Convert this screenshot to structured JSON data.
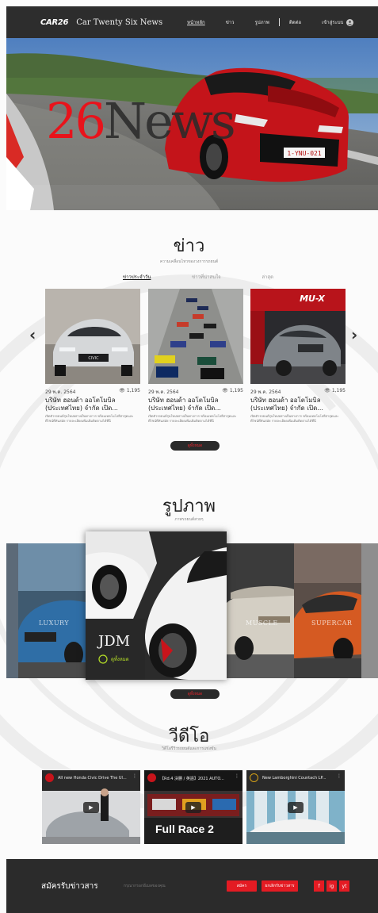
{
  "header": {
    "logo": "CAR26",
    "site_name": "Car Twenty Six News",
    "nav": [
      "หน้าหลัก",
      "ข่าว",
      "รูปภาพ",
      "ติดต่อ",
      "เข้าสู่ระบบ"
    ]
  },
  "hero": {
    "title_number": "26",
    "title_word": "News"
  },
  "news": {
    "title": "ข่าว",
    "subtitle": "ความเคลื่อนไหวของวงการรถยนต์",
    "tabs": [
      "ข่าวประจำวัน",
      "ข่าวที่น่าสนใจ",
      "ล่าสุด"
    ],
    "active_tab": 0,
    "cards": [
      {
        "date": "29 พ.ค. 2564",
        "views": "1,195",
        "title": "บริษัท ฮอนด้า ออโตโมบิล (ประเทศไทย) จำกัด เปิด...",
        "desc": "เปิดตัวรถยนต์รุ่นใหม่อย่างเป็นทางการ พร้อมเทคโนโลยีล่าสุดและดีไซน์ที่ทันสมัย รายละเอียดเพิ่มเติมติดตามได้ที่นี่"
      },
      {
        "date": "29 พ.ค. 2564",
        "views": "1,195",
        "title": "บริษัท ฮอนด้า ออโตโมบิล (ประเทศไทย) จำกัด เปิด...",
        "desc": "เปิดตัวรถยนต์รุ่นใหม่อย่างเป็นทางการ พร้อมเทคโนโลยีล่าสุดและดีไซน์ที่ทันสมัย รายละเอียดเพิ่มเติมติดตามได้ที่นี่"
      },
      {
        "date": "29 พ.ค. 2564",
        "views": "1,195",
        "title": "บริษัท ฮอนด้า ออโตโมบิล (ประเทศไทย) จำกัด เปิด...",
        "desc": "เปิดตัวรถยนต์รุ่นใหม่อย่างเป็นทางการ พร้อมเทคโนโลยีล่าสุดและดีไซน์ที่ทันสมัย รายละเอียดเพิ่มเติมติดตามได้ที่นี่"
      }
    ],
    "more_label": "ดูทั้งหมด"
  },
  "gallery": {
    "title": "รูปภาพ",
    "subtitle": "ภาพรถยนต์สวยๆ",
    "items": [
      "LUXURY",
      "JDM",
      "MUSCLE",
      "SUPERCAR"
    ],
    "featured_link": "ดูทั้งหมด",
    "more_label": "ดูทั้งหมด"
  },
  "videos": {
    "title": "วีดีโอ",
    "subtitle": "วิดีโอรีวิวรถยนต์และการแข่งขัน",
    "items": [
      {
        "title": "All new Honda Civic Drive The Ul..."
      },
      {
        "title": "【Rd.4 決勝 / 英語】2021 AUTO..."
      },
      {
        "title": "New Lamborghini Countach LP..."
      }
    ],
    "overlay_text": "Full Race 2"
  },
  "footer": {
    "title": "สมัครรับข่าวสาร",
    "input_placeholder": "กรุณากรอกอีเมลของคุณ",
    "subscribe_label": "สมัคร",
    "cancel_label": "ยกเลิกรับข่าวสาร",
    "social": [
      "f",
      "ig",
      "yt"
    ]
  },
  "colors": {
    "accent": "#e41b23",
    "dark": "#2b2b2b"
  }
}
